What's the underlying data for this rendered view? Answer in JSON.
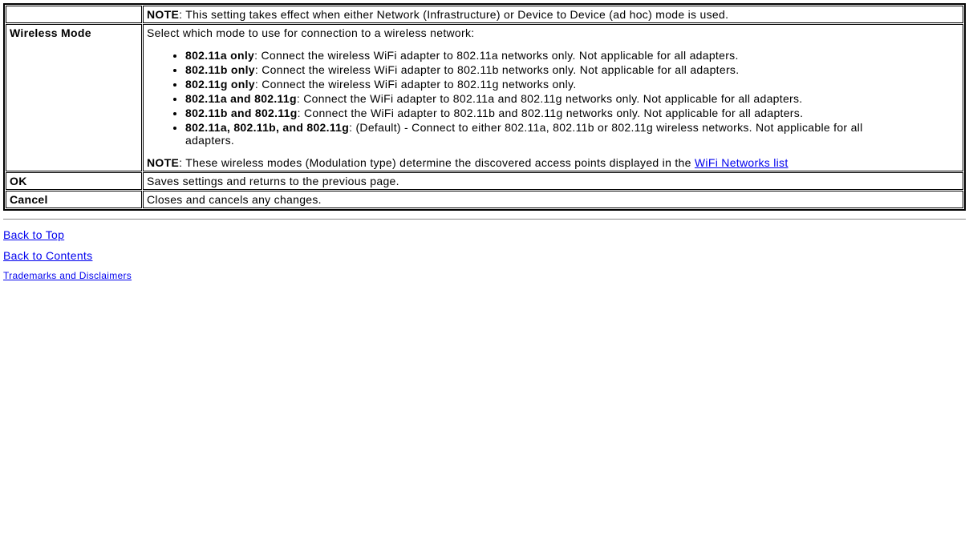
{
  "table": {
    "row0": {
      "label": "",
      "notePrefix": "NOTE",
      "noteText": ": This setting takes effect when either Network (Infrastructure) or Device to Device (ad hoc) mode is used."
    },
    "row1": {
      "label": "Wireless Mode",
      "intro": "Select which mode to use for connection to a wireless network:",
      "items": [
        {
          "bold": "802.11a only",
          "rest": ": Connect the wireless WiFi adapter to 802.11a networks only. Not applicable for all adapters."
        },
        {
          "bold": "802.11b only",
          "rest": ": Connect the wireless WiFi adapter to 802.11b networks only. Not applicable for all adapters."
        },
        {
          "bold": "802.11g only",
          "rest": ": Connect the wireless WiFi adapter to 802.11g networks only."
        },
        {
          "bold": "802.11a and 802.11g",
          "rest": ": Connect the WiFi adapter to 802.11a and 802.11g networks only. Not applicable for all adapters."
        },
        {
          "bold": "802.11b and 802.11g",
          "rest": ": Connect the WiFi adapter to 802.11b and 802.11g networks only. Not applicable for all adapters."
        },
        {
          "bold": "802.11a, 802.11b, and 802.11g",
          "rest": ": (Default) - Connect to either 802.11a, 802.11b or 802.11g wireless networks. Not applicable for all adapters."
        }
      ],
      "notePrefix": "NOTE",
      "noteText1": ": These wireless modes (Modulation type) determine the discovered access points displayed in the ",
      "noteLink": "WiFi Networks list"
    },
    "row2": {
      "label": "OK",
      "text": "Saves settings and returns to the previous page."
    },
    "row3": {
      "label": "Cancel",
      "text": "Closes and cancels any changes."
    }
  },
  "footer": {
    "backTop": "Back to Top",
    "backContents": "Back to Contents",
    "trademarks": "Trademarks and Disclaimers"
  }
}
